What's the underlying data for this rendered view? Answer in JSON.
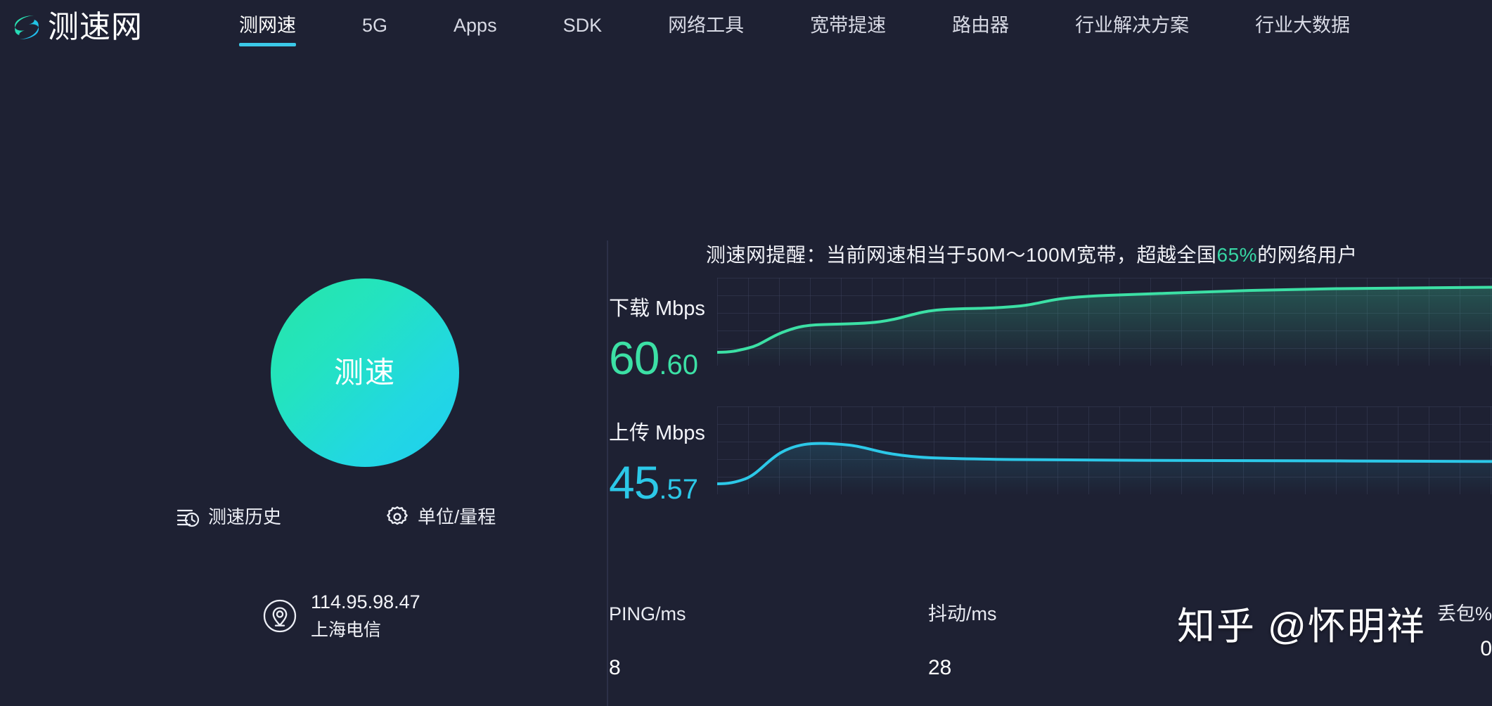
{
  "header": {
    "logo_icon": "speedtest-s-logo",
    "logo_text": "测速网",
    "nav": [
      {
        "label": "测网速",
        "active": true
      },
      {
        "label": "5G",
        "active": false
      },
      {
        "label": "Apps",
        "active": false
      },
      {
        "label": "SDK",
        "active": false
      },
      {
        "label": "网络工具",
        "active": false
      },
      {
        "label": "宽带提速",
        "active": false
      },
      {
        "label": "路由器",
        "active": false
      },
      {
        "label": "行业解决方案",
        "active": false
      },
      {
        "label": "行业大数据",
        "active": false
      }
    ]
  },
  "left": {
    "start_button_label": "测速",
    "history_icon": "history-list-clock-icon",
    "history_label": "测速历史",
    "units_icon": "gear-icon",
    "units_label": "单位/量程",
    "location_icon": "location-pin-circle-icon",
    "ip_address": "114.95.98.47",
    "isp": "上海电信"
  },
  "right": {
    "notice_prefix": "测速网提醒：当前网速相当于50M～100M宽带，超越全国",
    "notice_percent": "65%",
    "notice_suffix": "的网络用户",
    "download": {
      "title": "下载",
      "unit": "Mbps",
      "value_int": "60",
      "value_dec": ".60"
    },
    "upload": {
      "title": "上传",
      "unit": "Mbps",
      "value_int": "45",
      "value_dec": ".57"
    },
    "stats": [
      {
        "label": "PING/ms",
        "value": "8"
      },
      {
        "label": "抖动/ms",
        "value": "28"
      },
      {
        "label": "丢包%",
        "value": "0"
      }
    ]
  },
  "watermark": "知乎 @怀明祥",
  "colors": {
    "background": "#1E2133",
    "accent_green": "#3CE0A5",
    "accent_blue": "#2CC8E8",
    "nav_underline": "#3BC9E8",
    "divider": "#2C3048"
  },
  "chart_data": [
    {
      "type": "line",
      "name": "download",
      "title": "下载 Mbps",
      "ylabel": "Mbps",
      "xlabel": "",
      "grid": true,
      "legend": "none",
      "ylim": [
        0,
        80
      ],
      "color": "#3CE0A5",
      "x": [
        0,
        4,
        8,
        12,
        16,
        20,
        24,
        28,
        32,
        36,
        40,
        44,
        48,
        52,
        56,
        60,
        64,
        68,
        72,
        76,
        80,
        84,
        88,
        92,
        96,
        100
      ],
      "values": [
        10,
        10.5,
        12,
        17,
        25,
        31,
        33,
        33,
        34,
        36,
        40,
        44,
        46,
        47,
        47.5,
        48,
        50,
        53,
        56,
        58,
        58.5,
        59,
        59.5,
        60,
        60.4,
        60.6
      ]
    },
    {
      "type": "line",
      "name": "upload",
      "title": "上传 Mbps",
      "ylabel": "Mbps",
      "xlabel": "",
      "grid": true,
      "legend": "none",
      "ylim": [
        0,
        80
      ],
      "color": "#2CC8E8",
      "x": [
        0,
        4,
        8,
        12,
        16,
        20,
        24,
        28,
        32,
        36,
        40,
        44,
        48,
        52,
        56,
        60,
        64,
        68,
        72,
        76,
        80,
        84,
        88,
        92,
        96,
        100
      ],
      "values": [
        8,
        8.5,
        11,
        20,
        33,
        43,
        49,
        51,
        51,
        50,
        48,
        45,
        43,
        42,
        41.5,
        41.5,
        41.5,
        41.5,
        41.5,
        41.5,
        41.5,
        41.5,
        41.5,
        41.5,
        41.5,
        41.5
      ]
    }
  ]
}
